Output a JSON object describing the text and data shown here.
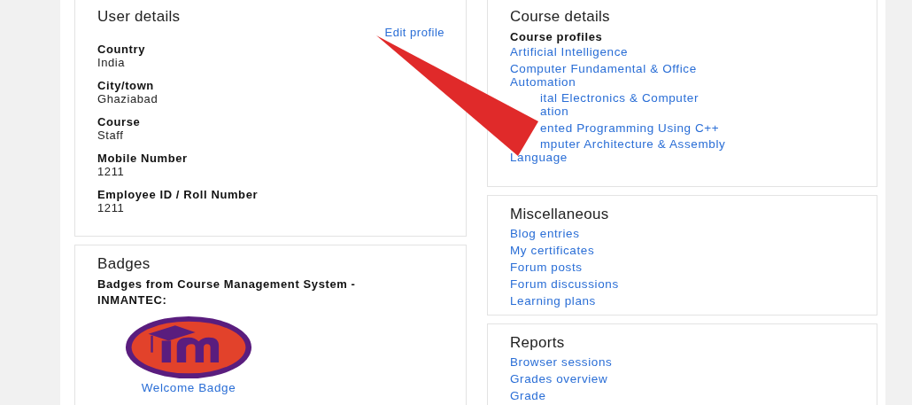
{
  "user_details": {
    "title": "User details",
    "edit_link": "Edit profile",
    "fields": [
      {
        "label": "Country",
        "value": "India"
      },
      {
        "label": "City/town",
        "value": "Ghaziabad"
      },
      {
        "label": "Course",
        "value": "Staff"
      },
      {
        "label": "Mobile Number",
        "value": "1211"
      },
      {
        "label": "Employee ID / Roll Number",
        "value": "1211"
      }
    ]
  },
  "badges": {
    "title": "Badges",
    "heading": "Badges from Course Management System - INMANTEC:",
    "items": [
      {
        "name": "Welcome Badge"
      }
    ]
  },
  "course_details": {
    "title": "Course details",
    "subtitle": "Course profiles",
    "courses": [
      {
        "lines": [
          {
            "text": "Artificial Intelligence",
            "kind": "whole"
          }
        ]
      },
      {
        "lines": [
          {
            "text": "Computer Fundamental & Office",
            "kind": "whole"
          },
          {
            "text": "Automation",
            "kind": "whole"
          }
        ]
      },
      {
        "lines": [
          {
            "text": "ital Electronics & Computer",
            "kind": "partial"
          },
          {
            "text": "ation",
            "kind": "partial"
          }
        ]
      },
      {
        "lines": [
          {
            "text": "ented Programming Using C++",
            "kind": "partial"
          }
        ]
      },
      {
        "lines": [
          {
            "text": "mputer Architecture & Assembly",
            "kind": "partial"
          },
          {
            "text": "Language",
            "kind": "whole"
          }
        ]
      }
    ]
  },
  "miscellaneous": {
    "title": "Miscellaneous",
    "links": [
      "Blog entries",
      "My certificates",
      "Forum posts",
      "Forum discussions",
      "Learning plans"
    ]
  },
  "reports": {
    "title": "Reports",
    "links": [
      "Browser sessions",
      "Grades overview",
      "Grade"
    ]
  },
  "annotation": {
    "kind": "arrow"
  }
}
